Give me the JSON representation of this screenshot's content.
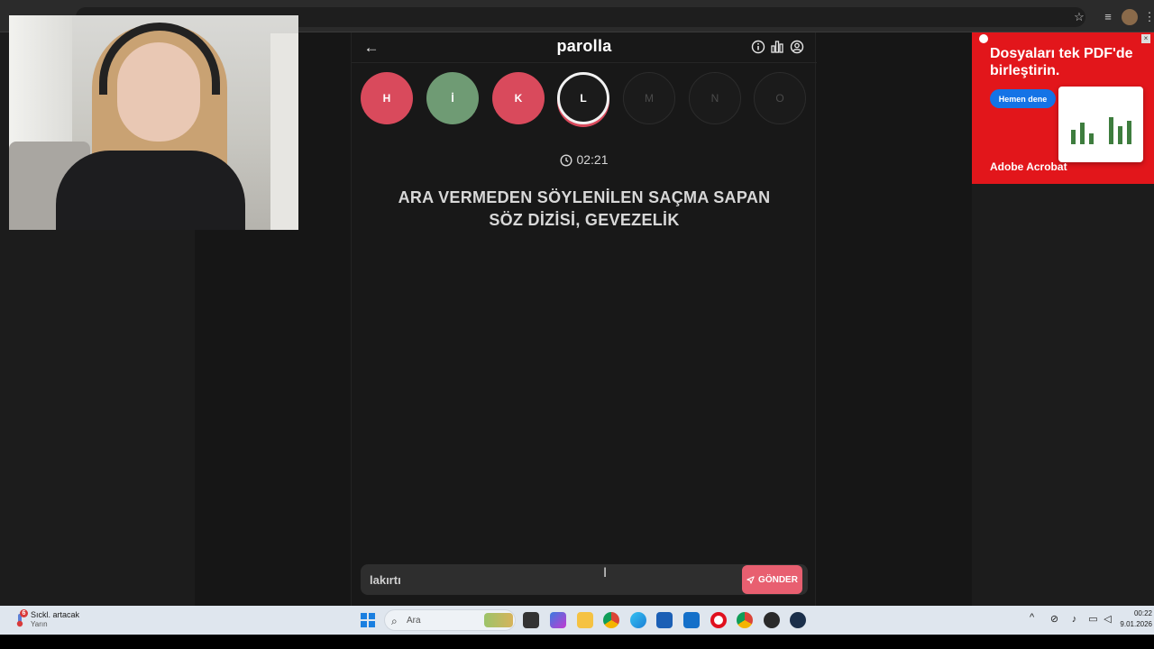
{
  "app": {
    "title": "parolla",
    "back_icon": "arrow-left-icon",
    "header_icons": [
      "info-icon",
      "stats-icon",
      "profile-icon"
    ]
  },
  "letters": [
    {
      "letter": "H",
      "state": "wrong"
    },
    {
      "letter": "İ",
      "state": "correct"
    },
    {
      "letter": "K",
      "state": "wrong"
    },
    {
      "letter": "L",
      "state": "current"
    },
    {
      "letter": "M",
      "state": "pending"
    },
    {
      "letter": "N",
      "state": "pending"
    },
    {
      "letter": "O",
      "state": "pending"
    }
  ],
  "timer": {
    "value": "02:21",
    "icon": "clock-icon"
  },
  "clue": {
    "text": "ARA VERMEDEN SÖYLENİLEN SAÇMA SAPAN SÖZ DİZİSİ, GEVEZELİK"
  },
  "answer": {
    "value": "lakırtı",
    "send_label": "GÖNDER",
    "send_icon": "send-icon"
  },
  "colors": {
    "wrong": "#d94a5c",
    "correct": "#6f9b74",
    "send": "#e85f70",
    "panel": "#181818"
  },
  "ad": {
    "headline": "Dosyaları tek PDF'de birleştirin.",
    "cta": "Hemen dene",
    "brand": "Adobe Acrobat",
    "background": "#e2161b"
  },
  "taskbar": {
    "weather_badge": "6",
    "weather_title": "Sıckl. artacak",
    "weather_sub": "Yarın",
    "search_placeholder": "Ara",
    "apps": [
      "file-explorer-icon",
      "widgets-icon",
      "folder-icon",
      "chrome-icon",
      "edge-icon",
      "store-icon",
      "outlook-icon",
      "opera-icon",
      "chrome-icon",
      "obs-icon",
      "steam-icon"
    ],
    "clock_time": "00:22",
    "clock_date": "9.01.2026"
  }
}
